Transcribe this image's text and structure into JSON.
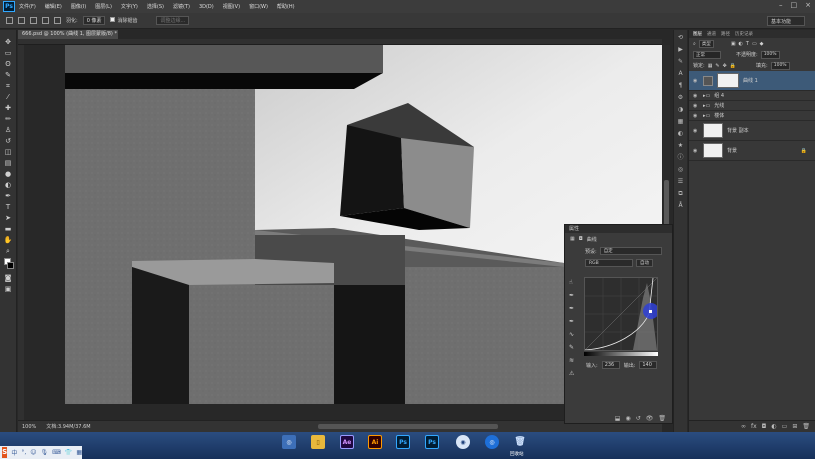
{
  "menubar": {
    "logo": "Ps",
    "items": [
      "文件(F)",
      "编辑(E)",
      "图像(I)",
      "图层(L)",
      "文字(Y)",
      "选择(S)",
      "滤镜(T)",
      "3D(D)",
      "视图(V)",
      "窗口(W)",
      "帮助(H)"
    ]
  },
  "options": {
    "feather_label": "羽化:",
    "feather_value": "0 像素",
    "antialias_label": "消除锯齿",
    "refine_edge": "调整边缘..."
  },
  "workspace": "基本功能",
  "document": {
    "tab_title": "666.psd @ 100% (曲线 1, 图层蒙版/8) *",
    "zoom": "100%",
    "doc_size": "文档:3.94M/37.6M"
  },
  "layers_panel": {
    "tabs": [
      "图层",
      "通道",
      "路径",
      "历史记录"
    ],
    "filter_kind": "类型",
    "blend_mode": "正常",
    "opacity_label": "不透明度:",
    "opacity_value": "100%",
    "lock_label": "锁定:",
    "fill_label": "填充:",
    "fill_value": "100%",
    "layers": [
      {
        "name": "曲线 1",
        "type": "adjustment",
        "selected": true
      },
      {
        "name": "组 4",
        "type": "group"
      },
      {
        "name": "光线",
        "type": "group"
      },
      {
        "name": "楼体",
        "type": "group"
      },
      {
        "name": "背景 副本",
        "type": "pixel"
      },
      {
        "name": "背景",
        "type": "pixel",
        "locked": true
      }
    ]
  },
  "properties_panel": {
    "header": "属性",
    "title": "曲线",
    "preset_label": "预设:",
    "preset_value": "自定",
    "channel_value": "RGB",
    "auto_button": "自动",
    "input_label": "输入:",
    "input_value": "236",
    "output_label": "输出:",
    "output_value": "140"
  },
  "taskbar": {
    "apps": [
      "Ae",
      "Ai",
      "Ps",
      "Ps"
    ],
    "recycle_label": "回收站"
  },
  "colors": {
    "accent_selected_layer": "#3d5a78",
    "ps_blue": "#31a8ff",
    "cursor_highlight": "#2f3fd6"
  }
}
